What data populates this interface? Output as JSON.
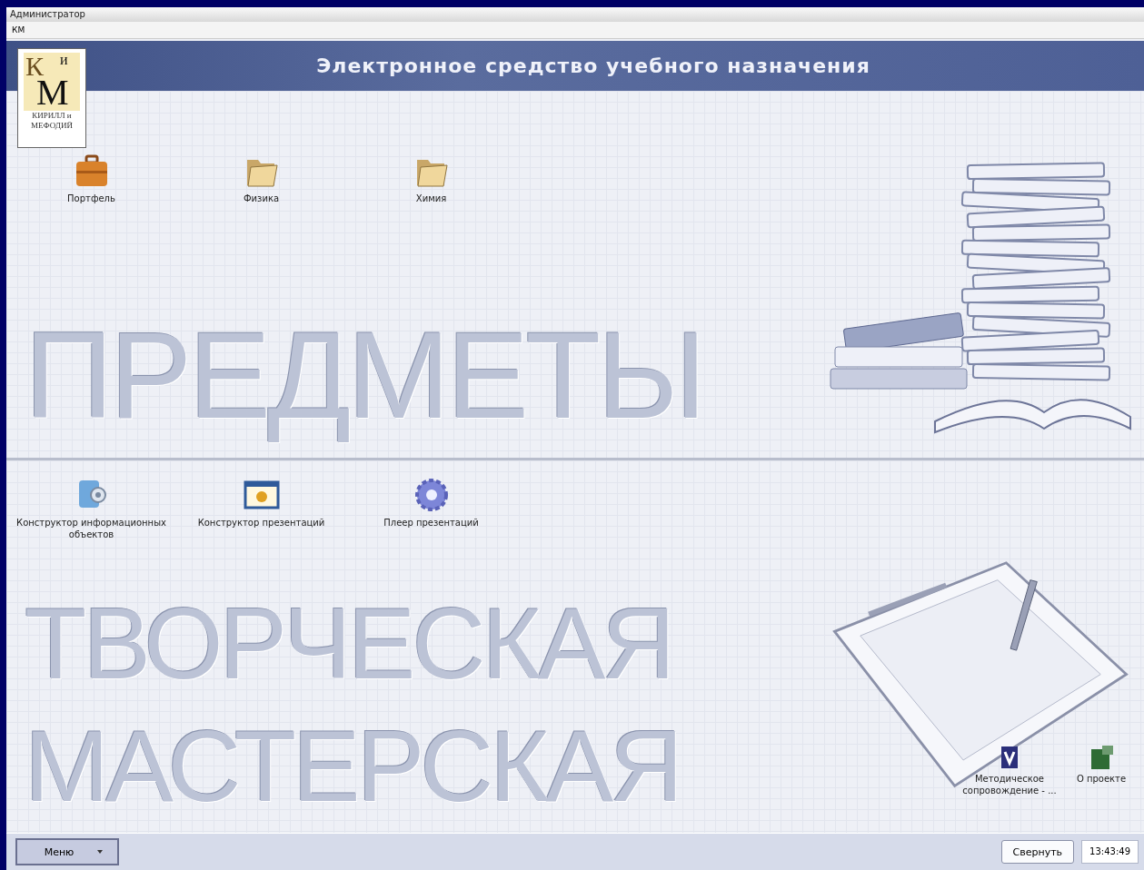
{
  "window": {
    "title": "Администратор",
    "menu": [
      "КМ"
    ]
  },
  "header": {
    "logo": {
      "letters": [
        "К",
        "и",
        "М"
      ],
      "caption": [
        "КИРИЛЛ и",
        "МЕФОДИЙ"
      ]
    },
    "title": "Электронное средство учебного назначения"
  },
  "subjects": {
    "watermark": [
      "ПРЕДМЕТЫ"
    ],
    "items": [
      {
        "label": "Портфель",
        "kind": "briefcase"
      },
      {
        "label": "Физика",
        "kind": "folder"
      },
      {
        "label": "Химия",
        "kind": "folder"
      }
    ]
  },
  "workshop": {
    "watermark": [
      "ТВОРЧЕСКАЯ",
      "МАСТЕРСКАЯ"
    ],
    "items": [
      {
        "label": "Конструктор информационных объектов",
        "kind": "constructor"
      },
      {
        "label": "Конструктор презентаций",
        "kind": "slide"
      },
      {
        "label": "Плеер презентаций",
        "kind": "disc"
      }
    ],
    "corner_items": [
      {
        "label": "Методическое сопровождение - ...",
        "kind": "guide"
      },
      {
        "label": "О проекте",
        "kind": "about"
      }
    ]
  },
  "taskbar": {
    "menu_button": "Меню",
    "minimize_button": "Свернуть",
    "clock": "13:43:49"
  }
}
